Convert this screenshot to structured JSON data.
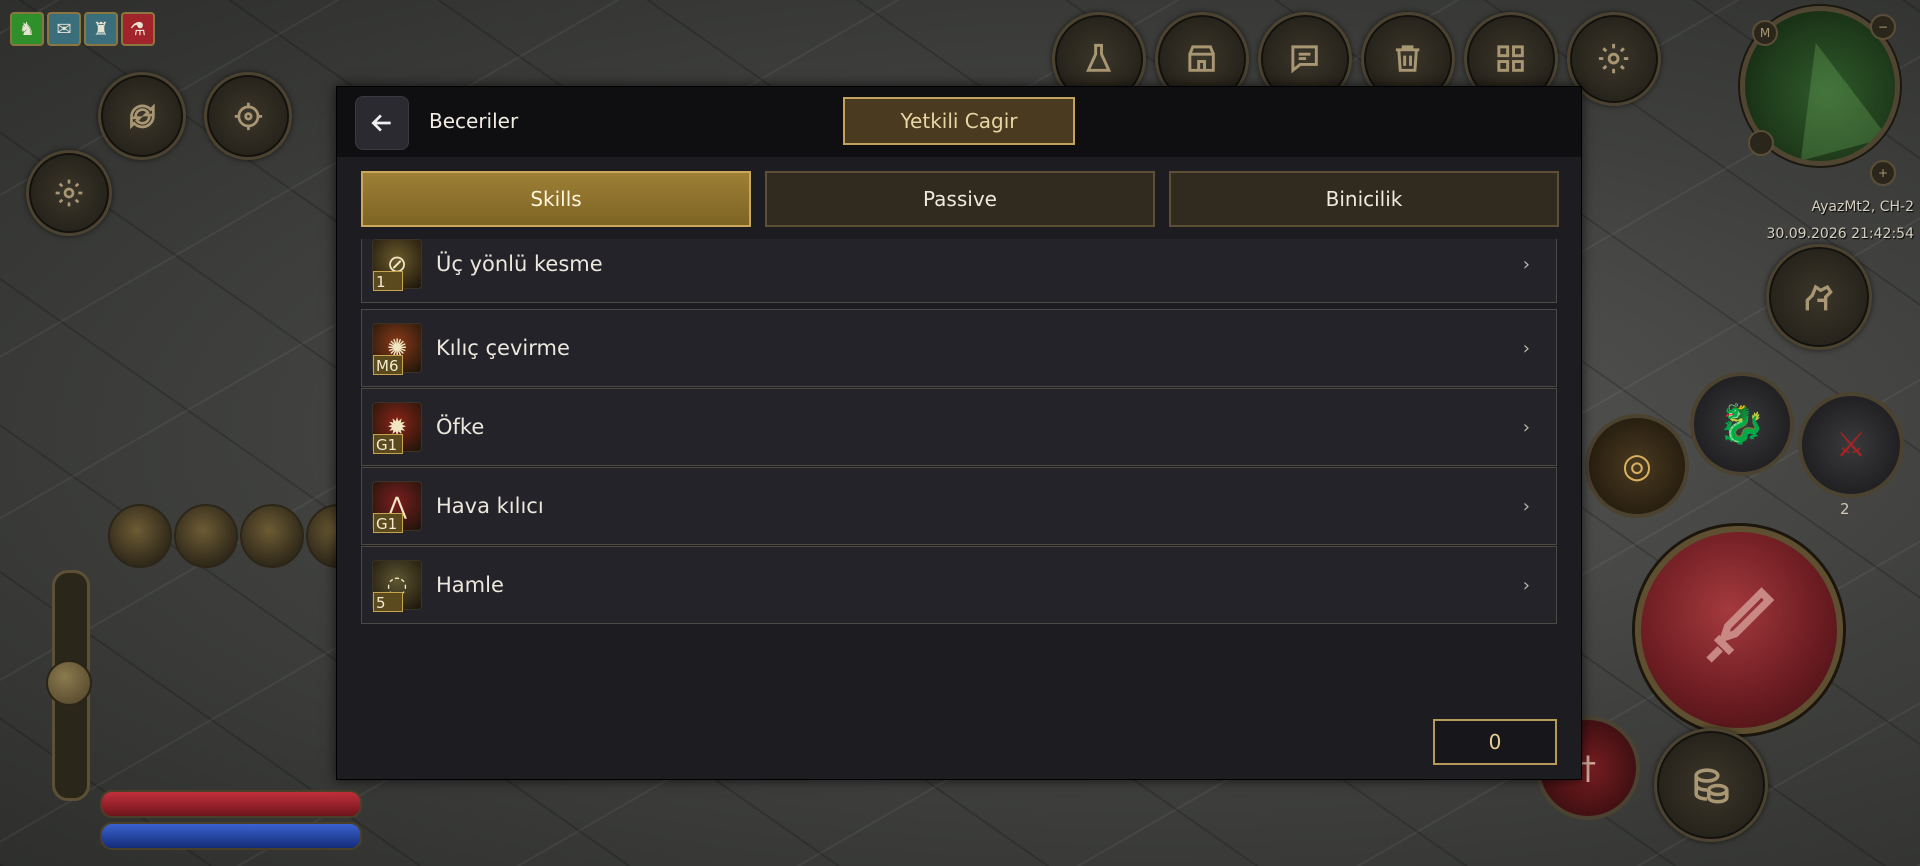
{
  "hud": {
    "buffs": [
      {
        "icon": "horse-buff-icon",
        "glyph": "♞",
        "color": "#2f8f2a"
      },
      {
        "icon": "scroll-buff-icon",
        "glyph": "✉",
        "color": "#3a6e7a"
      },
      {
        "icon": "statue-buff-icon",
        "glyph": "♜",
        "color": "#3a6e7a"
      },
      {
        "icon": "potion-buff-icon",
        "glyph": "⚗",
        "color": "#a0242a"
      }
    ],
    "top_buttons": [
      "potion-icon",
      "shop-icon",
      "chat-icon",
      "trash-icon",
      "grid-menu-icon",
      "settings-icon"
    ],
    "server": "AyazMt2, CH-2",
    "datetime": "30.09.2026 21:42:54",
    "slot_number": "2"
  },
  "dialog": {
    "title": "Beceriler",
    "gm_button": "Yetkili Cagir",
    "tabs": [
      {
        "label": "Skills",
        "active": true
      },
      {
        "label": "Passive",
        "active": false
      },
      {
        "label": "Binicilik",
        "active": false
      }
    ],
    "skills": [
      {
        "name": "Üç yönlü kesme",
        "level": "1",
        "glyph": "⊘",
        "color": "#6b5a2c"
      },
      {
        "name": "Kılıç çevirme",
        "level": "M6",
        "glyph": "✺",
        "color": "#8a3a18"
      },
      {
        "name": "Öfke",
        "level": "G1",
        "glyph": "✹",
        "color": "#8a2418"
      },
      {
        "name": "Hava kılıcı",
        "level": "G1",
        "glyph": "⋀",
        "color": "#7a1e1e"
      },
      {
        "name": "Hamle",
        "level": "5",
        "glyph": "◌",
        "color": "#5e5632"
      }
    ],
    "points": "0"
  }
}
